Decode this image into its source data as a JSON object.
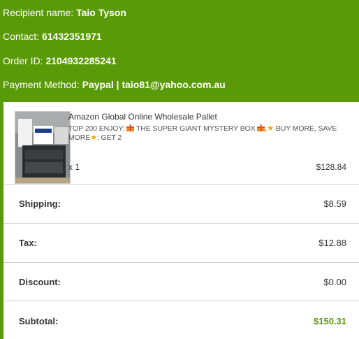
{
  "recipient": {
    "label": "Recipient name:",
    "value": "Taio Tyson"
  },
  "contact": {
    "label": "Contact:",
    "value": "61432351971"
  },
  "order": {
    "label": "Order ID:",
    "value": "2104932285241"
  },
  "payment": {
    "label": "Payment Method:",
    "value": "Paypal | taio81@yahoo.com.au"
  },
  "item": {
    "title": "Amazon Global Online Wholesale Pallet",
    "desc_1": "TOP 200 ENJOY:",
    "desc_2": "THE SUPER GIANT MYSTERY BOX",
    "desc_3": ",",
    "desc_4": "BUY MORE, SAVE MORE",
    "desc_5": ": GET 2",
    "quantity": "x 1",
    "price": "$128.84"
  },
  "summary": {
    "shipping_label": "Shipping:",
    "shipping_value": "$8.59",
    "tax_label": "Tax:",
    "tax_value": "$12.88",
    "discount_label": "Discount:",
    "discount_value": "$0.00",
    "subtotal_label": "Subtotal:",
    "subtotal_value": "$150.31"
  },
  "colors": {
    "accent": "#5a9a08",
    "gift": "#f28c28",
    "star": "#f0a500"
  }
}
